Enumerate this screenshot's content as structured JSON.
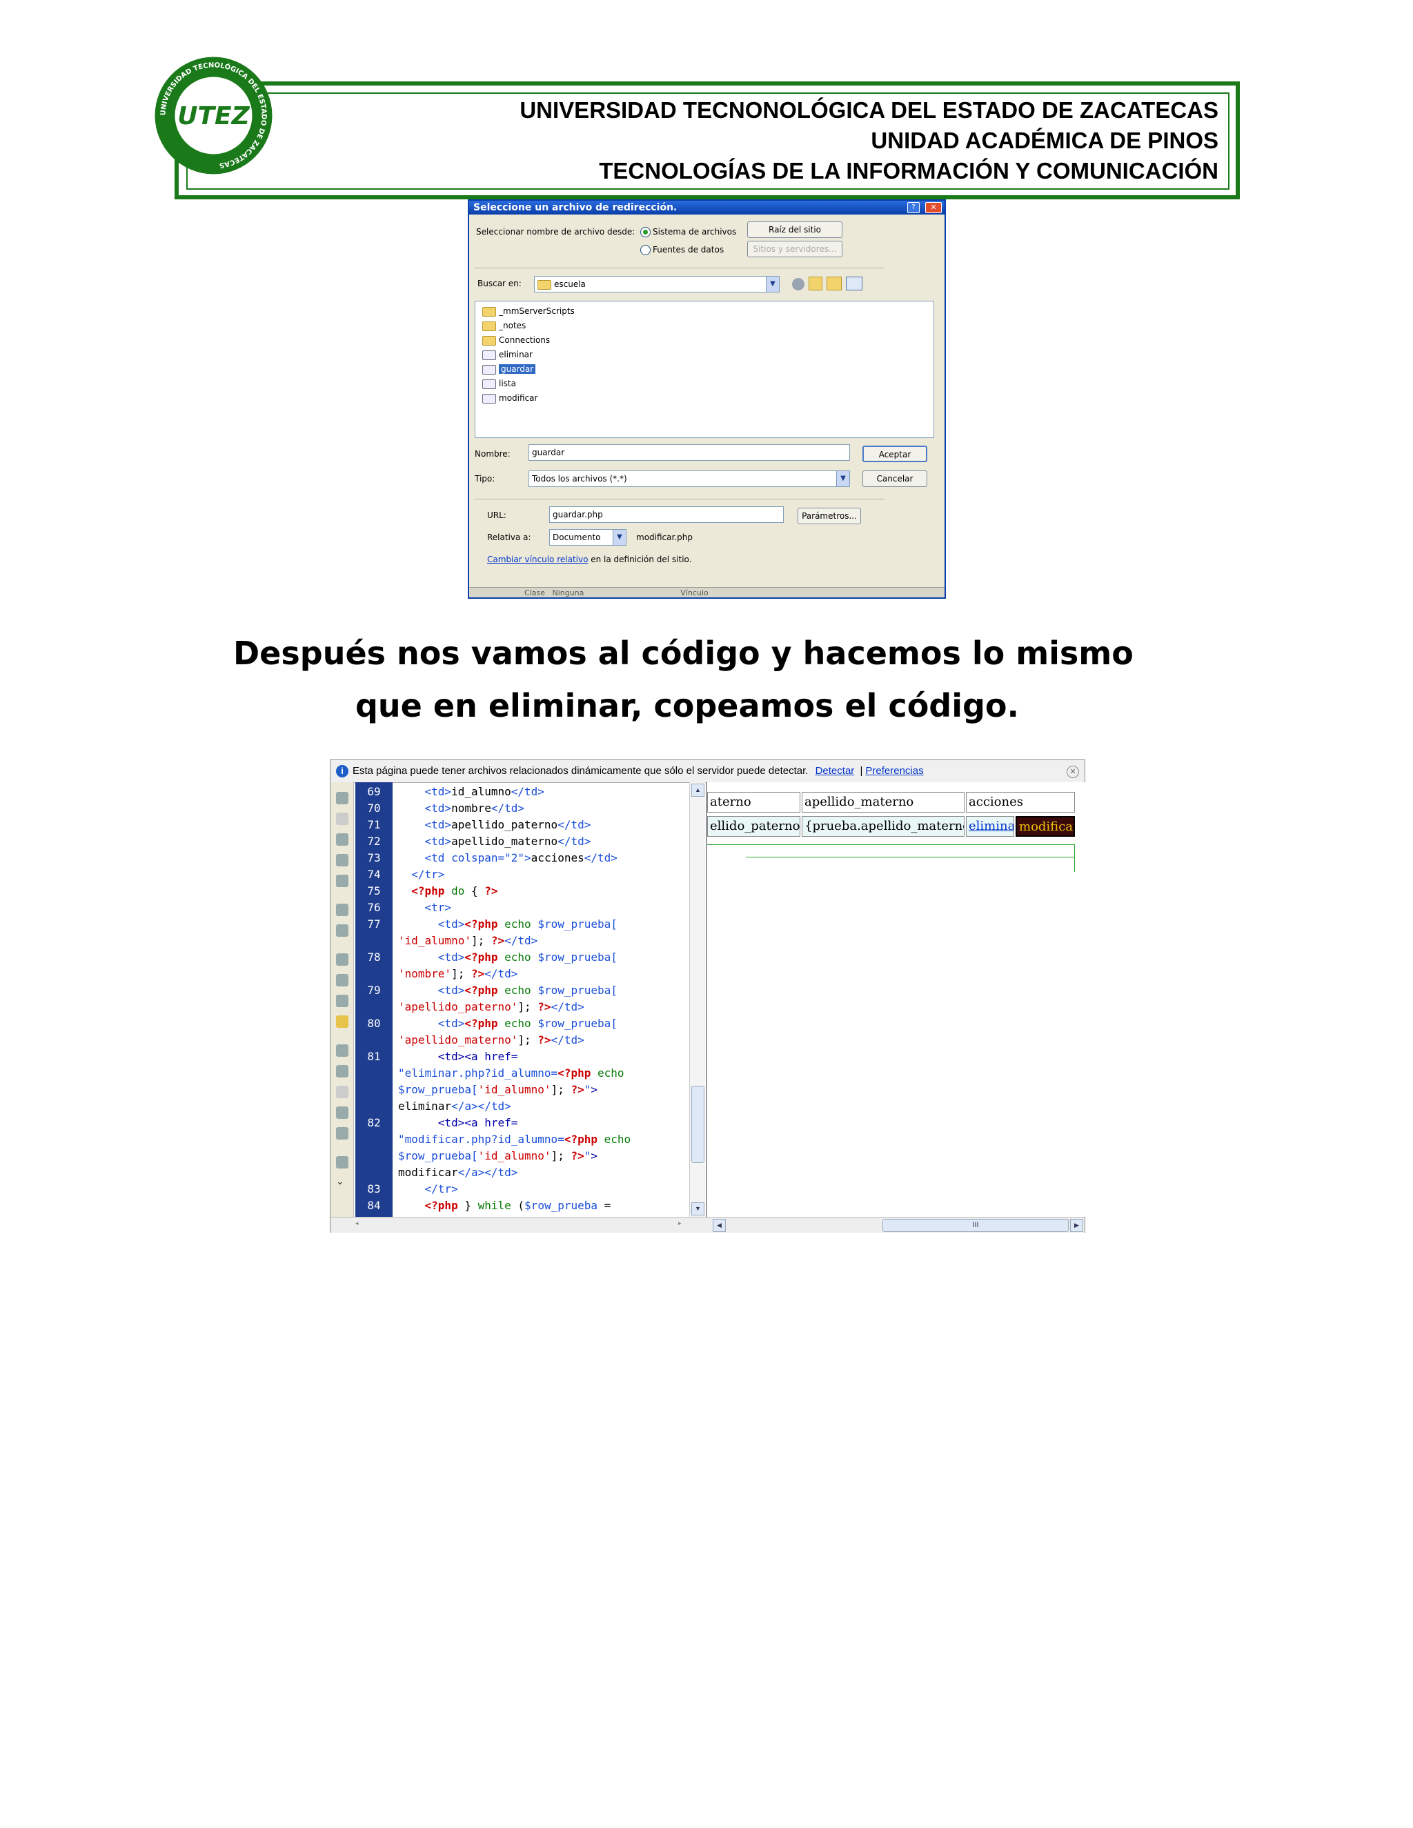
{
  "header": {
    "line1": "UNIVERSIDAD TECNONOLÓGICA DEL ESTADO DE ZACATECAS",
    "line2": "UNIDAD ACADÉMICA DE PINOS",
    "line3": "TECNOLOGÍAS DE LA INFORMACIÓN Y COMUNICACIÓN",
    "logo_text": "UTEZ",
    "logo_ring_text": "UNIVERSIDAD TECNOLÓGICA DEL ESTADO DE ZACATECAS"
  },
  "dialog": {
    "title": "Seleccione un archivo de redirección.",
    "select_from_label": "Seleccionar nombre de archivo desde:",
    "option_filesystem": "Sistema de archivos",
    "option_datasources": "Fuentes de datos",
    "btn_site_root": "Raíz del sitio",
    "btn_sites_servers": "Sitios y servidores...",
    "look_in_label": "Buscar en:",
    "look_in_value": "escuela",
    "files": [
      {
        "name": "_mmServerScripts",
        "type": "folder"
      },
      {
        "name": "_notes",
        "type": "folder"
      },
      {
        "name": "Connections",
        "type": "folder"
      },
      {
        "name": "eliminar",
        "type": "php"
      },
      {
        "name": "guardar",
        "type": "php"
      },
      {
        "name": "lista",
        "type": "php"
      },
      {
        "name": "modificar",
        "type": "php"
      }
    ],
    "name_label": "Nombre:",
    "name_value": "guardar",
    "type_label": "Tipo:",
    "type_value": "Todos los archivos (*.*)",
    "btn_accept": "Aceptar",
    "btn_cancel": "Cancelar",
    "url_label": "URL:",
    "url_value": "guardar.php",
    "btn_params": "Parámetros...",
    "relative_label": "Relativa a:",
    "relative_value": "Documento",
    "relative_file": "modificar.php",
    "change_link": "Cambiar vínculo relativo",
    "change_link_suffix": " en la definición del sitio.",
    "bottom_strip": "Clase   Ninguna                                        Vínculo"
  },
  "body_text": {
    "line1": "Después nos  vamos  al  código y hacemos  lo  mismo",
    "line2": "que  en eliminar,  copeamos  el  código."
  },
  "editor": {
    "info_text": "Esta página puede tener archivos relacionados dinámicamente que sólo el servidor puede detectar.",
    "detect_link": "Detectar",
    "separator": "|",
    "prefs_link": "Preferencias",
    "line_numbers": [
      "69",
      "70",
      "71",
      "72",
      "73",
      "74",
      "75",
      "76",
      "77",
      "78",
      "79",
      "80",
      "81",
      "82",
      "83",
      "84"
    ],
    "design_headers": [
      "aterno",
      "apellido_materno",
      "acciones"
    ],
    "design_cells": [
      "ellido_paterno}",
      "{prueba.apellido_materno}",
      "eliminar",
      "modificar"
    ],
    "scroll_label": "III"
  }
}
